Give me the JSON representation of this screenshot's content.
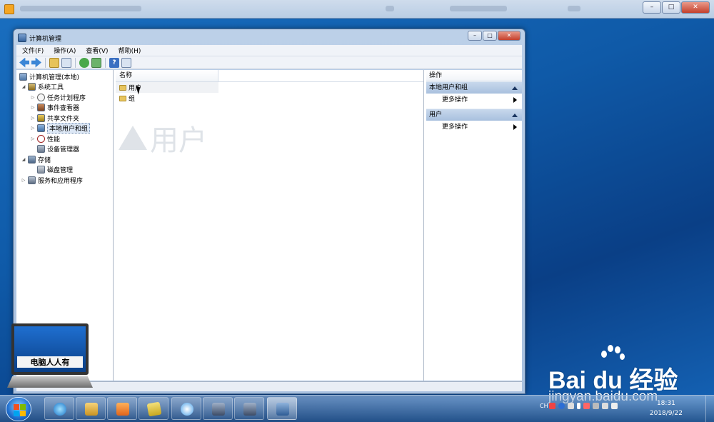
{
  "window": {
    "title": "计算机管理",
    "min_label": "–",
    "max_label": "□",
    "close_label": "✕"
  },
  "menu": [
    "文件(F)",
    "操作(A)",
    "查看(V)",
    "帮助(H)"
  ],
  "tree": {
    "root": "计算机管理(本地)",
    "system_tools": "系统工具",
    "task_scheduler": "任务计划程序",
    "event_viewer": "事件查看器",
    "shared_folders": "共享文件夹",
    "local_users_groups": "本地用户和组",
    "performance": "性能",
    "device_manager": "设备管理器",
    "storage": "存储",
    "disk_management": "磁盘管理",
    "services_apps": "服务和应用程序"
  },
  "list": {
    "column_name": "名称",
    "rows": [
      "用户",
      "组"
    ],
    "watermark_text": "用户"
  },
  "actions": {
    "header": "操作",
    "section1": "本地用户和组",
    "section1_item": "更多操作",
    "section2": "用户",
    "section2_item": "更多操作"
  },
  "logo": {
    "text": "电脑人人有"
  },
  "baidu": {
    "brand": "Bai du 经验",
    "url": "jingyan.baidu.com"
  },
  "taskbar": {
    "ime": "CH",
    "time": "18:31",
    "date": "2018/9/22"
  },
  "colors": {
    "accent": "#1f6fd0",
    "selection": "#dce7f5",
    "action_section": "#b8cce6"
  }
}
